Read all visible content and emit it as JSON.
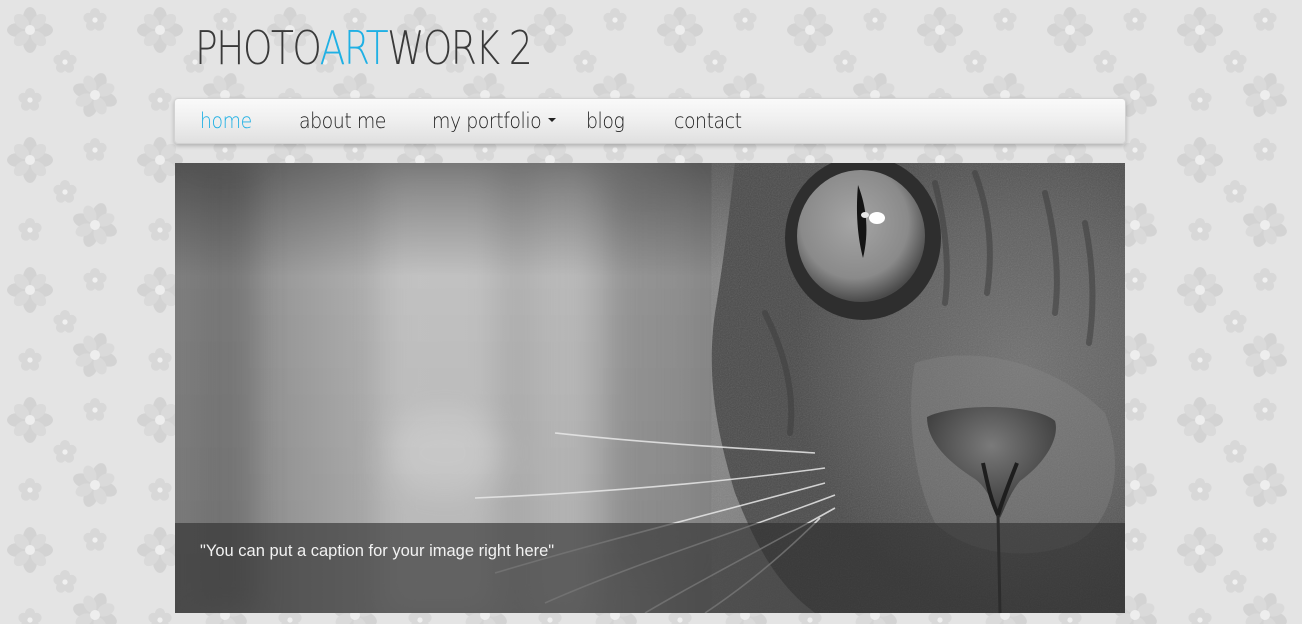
{
  "logo": {
    "part1": "PHOTO",
    "part2": "ART",
    "part3": "WORK 2",
    "accent_color": "#1fb0e4"
  },
  "nav": {
    "items": [
      {
        "label": "home",
        "active": true
      },
      {
        "label": "about me",
        "active": false
      },
      {
        "label": "my portfolio",
        "active": false,
        "has_dropdown": true
      },
      {
        "label": "blog",
        "active": false
      },
      {
        "label": "contact",
        "active": false
      }
    ]
  },
  "hero": {
    "caption": "\"You can put a caption for your image right here\""
  },
  "colors": {
    "background": "#e4e4e4",
    "active_nav": "#1fb0e4",
    "nav_text": "#222222"
  }
}
